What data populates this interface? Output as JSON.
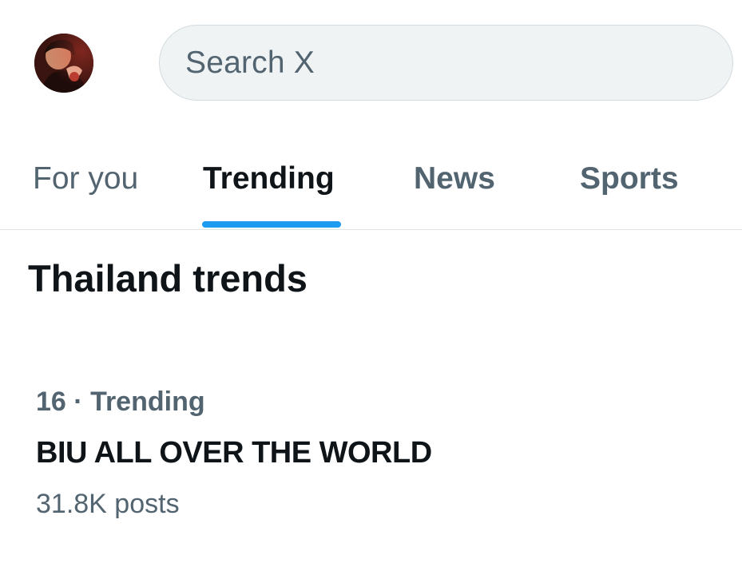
{
  "header": {
    "avatar_icon": "profile-avatar",
    "search": {
      "placeholder": "Search X"
    }
  },
  "tabs": [
    {
      "label": "For you",
      "active": false
    },
    {
      "label": "Trending",
      "active": true
    },
    {
      "label": "News",
      "active": false
    },
    {
      "label": "Sports",
      "active": false
    }
  ],
  "section": {
    "title": "Thailand trends"
  },
  "trends": [
    {
      "rank": "16",
      "separator": "·",
      "category": "Trending",
      "name": "BIU ALL OVER THE WORLD",
      "posts": "31.8K posts"
    }
  ],
  "colors": {
    "accent": "#1d9bf0",
    "primary_text": "#0f1419",
    "secondary_text": "#536471",
    "search_bg": "#eff3f4"
  }
}
